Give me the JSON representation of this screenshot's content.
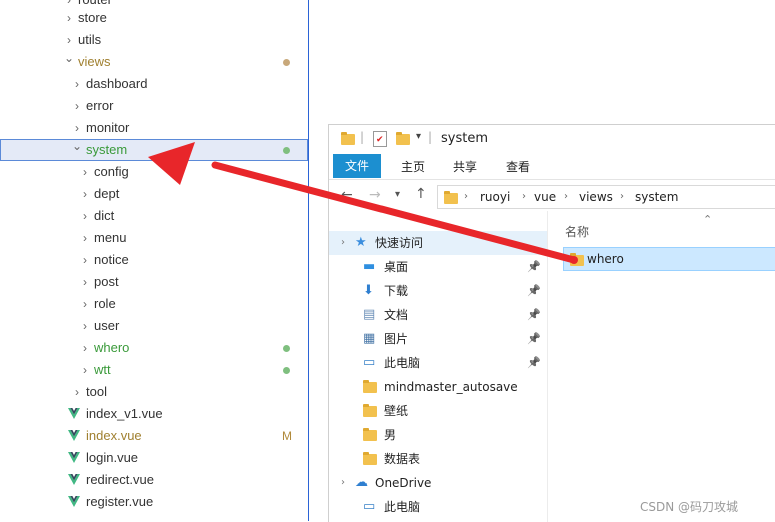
{
  "tree": {
    "partial_top": "router",
    "items": [
      {
        "label": "store",
        "kind": "folder",
        "level": 1,
        "open": false
      },
      {
        "label": "utils",
        "kind": "folder",
        "level": 1,
        "open": false
      },
      {
        "label": "views",
        "kind": "folder",
        "level": 1,
        "open": true,
        "color": "olive",
        "dot": "#c8a87a"
      },
      {
        "label": "dashboard",
        "kind": "folder",
        "level": 2,
        "open": false
      },
      {
        "label": "error",
        "kind": "folder",
        "level": 2,
        "open": false
      },
      {
        "label": "monitor",
        "kind": "folder",
        "level": 2,
        "open": false
      },
      {
        "label": "system",
        "kind": "folder",
        "level": 2,
        "open": true,
        "color": "green",
        "dot": "#7fbf7f",
        "selected": true
      },
      {
        "label": "config",
        "kind": "folder",
        "level": 3,
        "open": false
      },
      {
        "label": "dept",
        "kind": "folder",
        "level": 3,
        "open": false
      },
      {
        "label": "dict",
        "kind": "folder",
        "level": 3,
        "open": false
      },
      {
        "label": "menu",
        "kind": "folder",
        "level": 3,
        "open": false
      },
      {
        "label": "notice",
        "kind": "folder",
        "level": 3,
        "open": false
      },
      {
        "label": "post",
        "kind": "folder",
        "level": 3,
        "open": false
      },
      {
        "label": "role",
        "kind": "folder",
        "level": 3,
        "open": false
      },
      {
        "label": "user",
        "kind": "folder",
        "level": 3,
        "open": false
      },
      {
        "label": "whero",
        "kind": "folder",
        "level": 3,
        "open": false,
        "color": "green",
        "dot": "#7fbf7f"
      },
      {
        "label": "wtt",
        "kind": "folder",
        "level": 3,
        "open": false,
        "color": "green",
        "dot": "#7fbf7f"
      },
      {
        "label": "tool",
        "kind": "folder",
        "level": 2,
        "open": false
      },
      {
        "label": "index_v1.vue",
        "kind": "vue",
        "level": 2
      },
      {
        "label": "index.vue",
        "kind": "vue",
        "level": 2,
        "color": "olive",
        "mark": "M"
      },
      {
        "label": "login.vue",
        "kind": "vue",
        "level": 2
      },
      {
        "label": "redirect.vue",
        "kind": "vue",
        "level": 2
      },
      {
        "label": "register.vue",
        "kind": "vue",
        "level": 2
      }
    ]
  },
  "explorer": {
    "title": "system",
    "tabs": [
      {
        "label": "文件",
        "active": true
      },
      {
        "label": "主页",
        "active": false
      },
      {
        "label": "共享",
        "active": false
      },
      {
        "label": "查看",
        "active": false
      }
    ],
    "breadcrumb": [
      "ruoyi",
      "vue",
      "views",
      "system"
    ],
    "column_header": "名称",
    "nav": [
      {
        "label": "快速访问",
        "icon": "star-icon",
        "pinned": false,
        "header": true
      },
      {
        "label": "桌面",
        "icon": "desktop-icon",
        "pinned": true
      },
      {
        "label": "下载",
        "icon": "download-icon",
        "pinned": true
      },
      {
        "label": "文档",
        "icon": "document-icon",
        "pinned": true
      },
      {
        "label": "图片",
        "icon": "picture-icon",
        "pinned": true
      },
      {
        "label": "此电脑",
        "icon": "computer-icon",
        "pinned": true
      },
      {
        "label": "mindmaster_autosave",
        "icon": "folder-icon",
        "pinned": false
      },
      {
        "label": "壁纸",
        "icon": "folder-icon",
        "pinned": false
      },
      {
        "label": "男",
        "icon": "folder-icon",
        "pinned": false
      },
      {
        "label": "数据表",
        "icon": "folder-icon",
        "pinned": false
      },
      {
        "label": "OneDrive",
        "icon": "cloud-icon",
        "pinned": false,
        "header": true
      },
      {
        "label": "此电脑",
        "icon": "computer-icon",
        "pinned": false,
        "partial": true
      }
    ],
    "files": [
      {
        "name": "whero",
        "selected": true
      }
    ]
  },
  "watermark": "CSDN @码刀攻城",
  "colors": {
    "accent_tab": "#1c8fd0",
    "arrow": "#e8262a",
    "selection": "#cce8ff",
    "git_green": "#3a9a3a",
    "git_modified": "#a08030"
  }
}
